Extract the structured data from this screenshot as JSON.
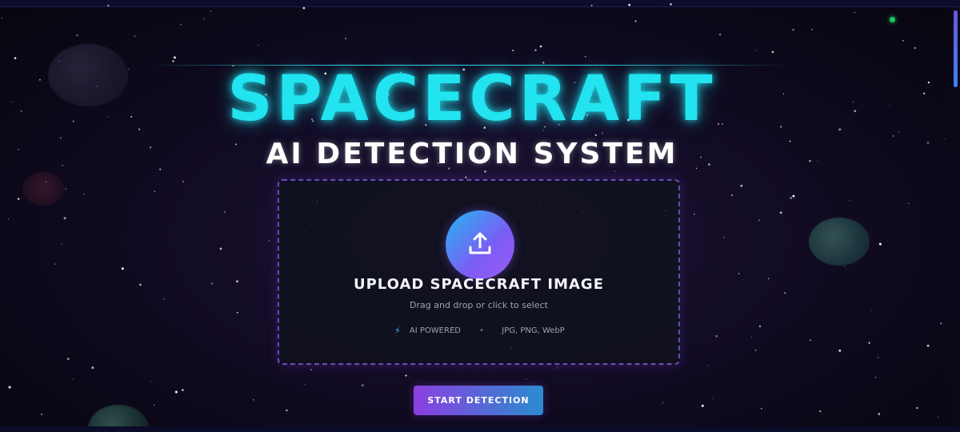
{
  "hero": {
    "title": "SPACECRAFT",
    "subtitle": "AI DETECTION SYSTEM",
    "accent_color": "#22e3f0"
  },
  "upload": {
    "icon": "upload-icon",
    "title": "UPLOAD SPACECRAFT IMAGE",
    "subtitle": "Drag and drop or click to select",
    "badge_icon": "lightning-icon",
    "badge_label": "AI POWERED",
    "separator": "•",
    "formats": "JPG, PNG, WebP"
  },
  "actions": {
    "start_label": "START DETECTION"
  },
  "colors": {
    "background": "#0b0818",
    "upload_border": "#6b4ab8",
    "button_gradient_start": "#8b3fe0",
    "button_gradient_end": "#2a8cd0",
    "status_dot": "#22c55e"
  }
}
